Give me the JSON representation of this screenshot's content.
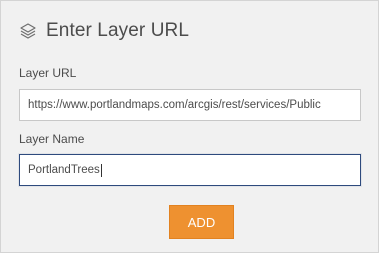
{
  "header": {
    "title": "Enter Layer URL",
    "icon": "layers-icon"
  },
  "form": {
    "url_label": "Layer URL",
    "url_value": "https://www.portlandmaps.com/arcgis/rest/services/Public",
    "name_label": "Layer Name",
    "name_value": "PortlandTrees"
  },
  "actions": {
    "add_label": "ADD"
  },
  "colors": {
    "accent": "#ee9130",
    "focus_border": "#2e4a7d"
  }
}
